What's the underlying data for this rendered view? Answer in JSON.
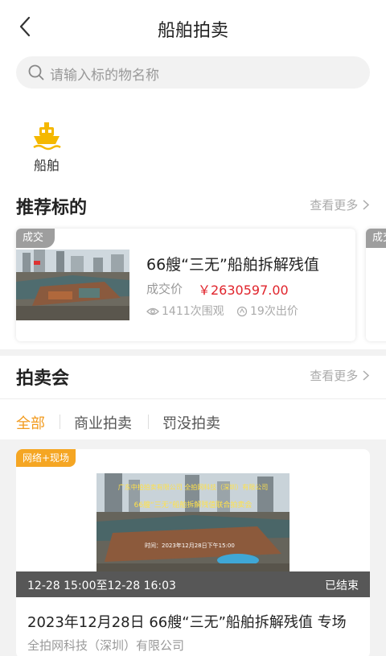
{
  "header": {
    "title": "船舶拍卖"
  },
  "search": {
    "placeholder": "请输入标的物名称"
  },
  "categories": [
    {
      "label": "船舶",
      "icon": "ship-icon"
    }
  ],
  "recommended": {
    "title": "推荐标的",
    "more": "查看更多",
    "items": [
      {
        "tag": "成交",
        "name": "66艘“三无”船舶拆解残值",
        "price_label": "成交价",
        "price": "￥2630597.00",
        "views": "1411次围观",
        "bids": "19次出价"
      }
    ],
    "next_tag": "成交"
  },
  "auction": {
    "title": "拍卖会",
    "more": "查看更多",
    "tabs": [
      "全部",
      "商业拍卖",
      "罚没拍卖"
    ],
    "active_tab": 0,
    "card": {
      "mode": "网络+现场",
      "time_range": "12-28 15:00至12-28 16:03",
      "status": "已结束",
      "title": "2023年12月28日 66艘“三无”船舶拆解残值 专场",
      "org": "全拍网科技（深圳）有限公司",
      "banner_lines": [
        "广东中拍拍卖有限公司  全拍网科技（深圳）有限公司",
        "66艘“三无”船舶拆解残值联合拍卖会"
      ],
      "banner_time": "时间：2023年12月28日下午15:00"
    }
  },
  "colors": {
    "accent": "#f29a1c",
    "price": "#e0242c",
    "badge": "#f5a623"
  }
}
